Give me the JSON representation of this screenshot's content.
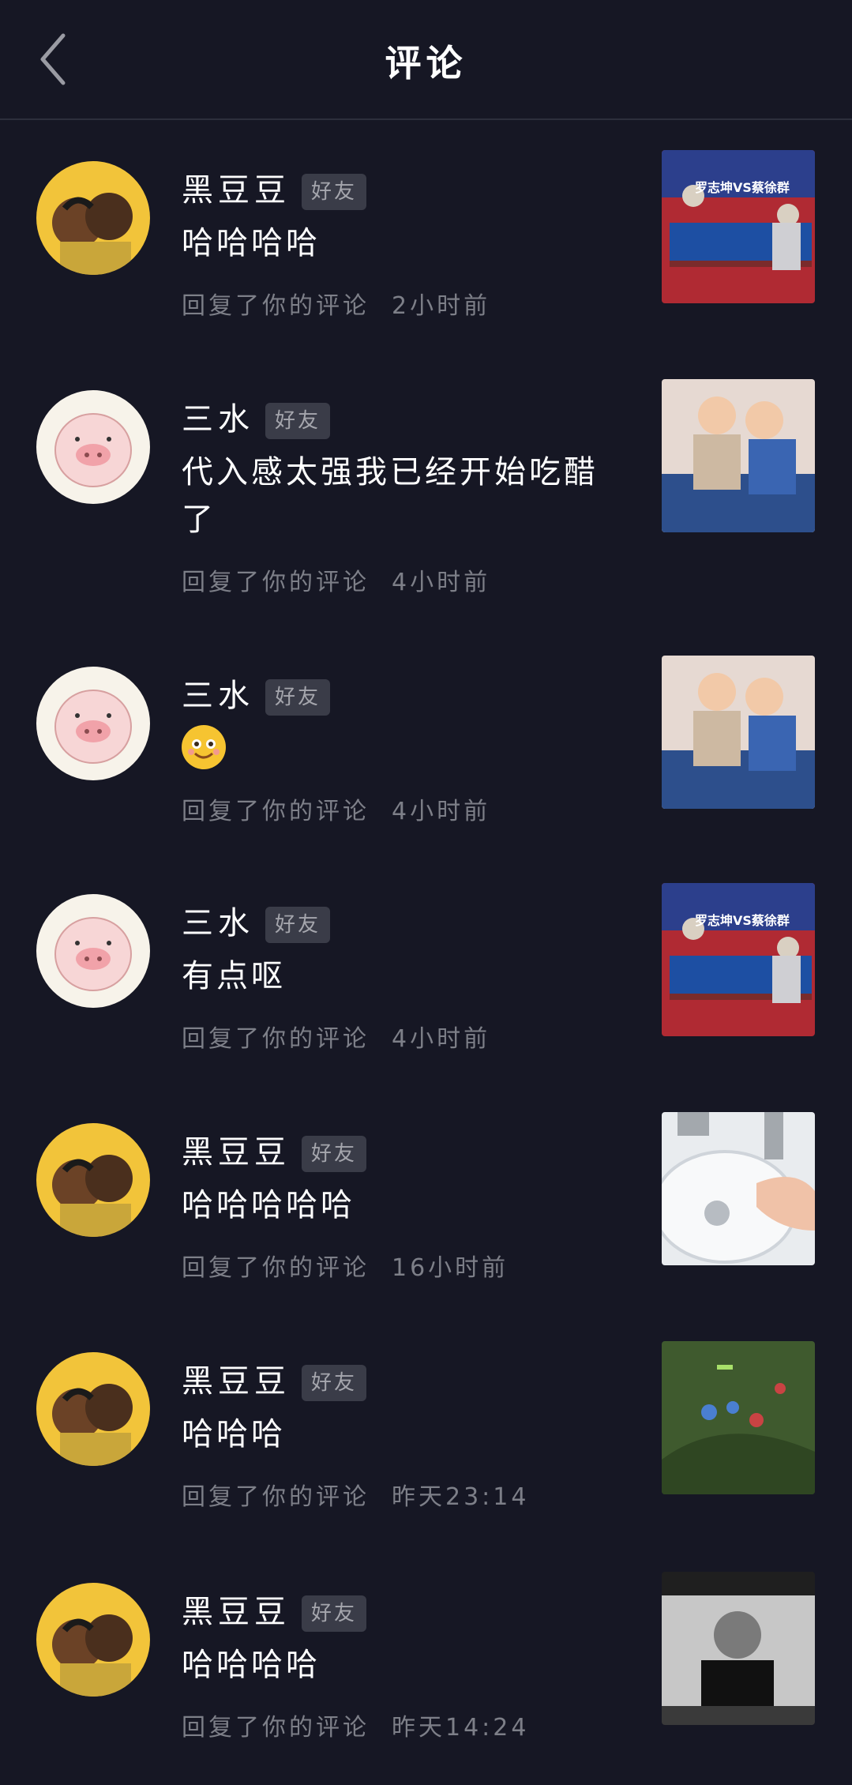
{
  "header": {
    "title": "评论"
  },
  "notifications": [
    {
      "name": "黑豆豆",
      "badge": "好友",
      "comment": "哈哈哈哈",
      "action": "回复了你的评论",
      "time": "2小时前",
      "avatar": "couple-cartoon",
      "thumb": "table-tennis"
    },
    {
      "name": "三水",
      "badge": "好友",
      "comment": "代入感太强我已经开始吃醋了",
      "action": "回复了你的评论",
      "time": "4小时前",
      "avatar": "pig-cartoon",
      "thumb": "kids-hug"
    },
    {
      "name": "三水",
      "badge": "好友",
      "comment": "",
      "emoji": "smiling-face-emoji",
      "action": "回复了你的评论",
      "time": "4小时前",
      "avatar": "pig-cartoon",
      "thumb": "kids-hug"
    },
    {
      "name": "三水",
      "badge": "好友",
      "comment": "有点呕",
      "action": "回复了你的评论",
      "time": "4小时前",
      "avatar": "pig-cartoon",
      "thumb": "table-tennis"
    },
    {
      "name": "黑豆豆",
      "badge": "好友",
      "comment": "哈哈哈哈哈",
      "action": "回复了你的评论",
      "time": "16小时前",
      "avatar": "couple-cartoon",
      "thumb": "sink-hand"
    },
    {
      "name": "黑豆豆",
      "badge": "好友",
      "comment": "哈哈哈",
      "action": "回复了你的评论",
      "time": "昨天23:14",
      "avatar": "couple-cartoon",
      "thumb": "game-map"
    },
    {
      "name": "黑豆豆",
      "badge": "好友",
      "comment": "哈哈哈哈",
      "action": "回复了你的评论",
      "time": "昨天14:24",
      "avatar": "couple-cartoon",
      "thumb": "bw-man"
    }
  ],
  "thumb_captions": {
    "table-tennis": "罗志坤VS蔡徐群"
  },
  "colors": {
    "background": "#161724",
    "badge_bg": "#3a3c48",
    "meta": "#7d7f88"
  }
}
